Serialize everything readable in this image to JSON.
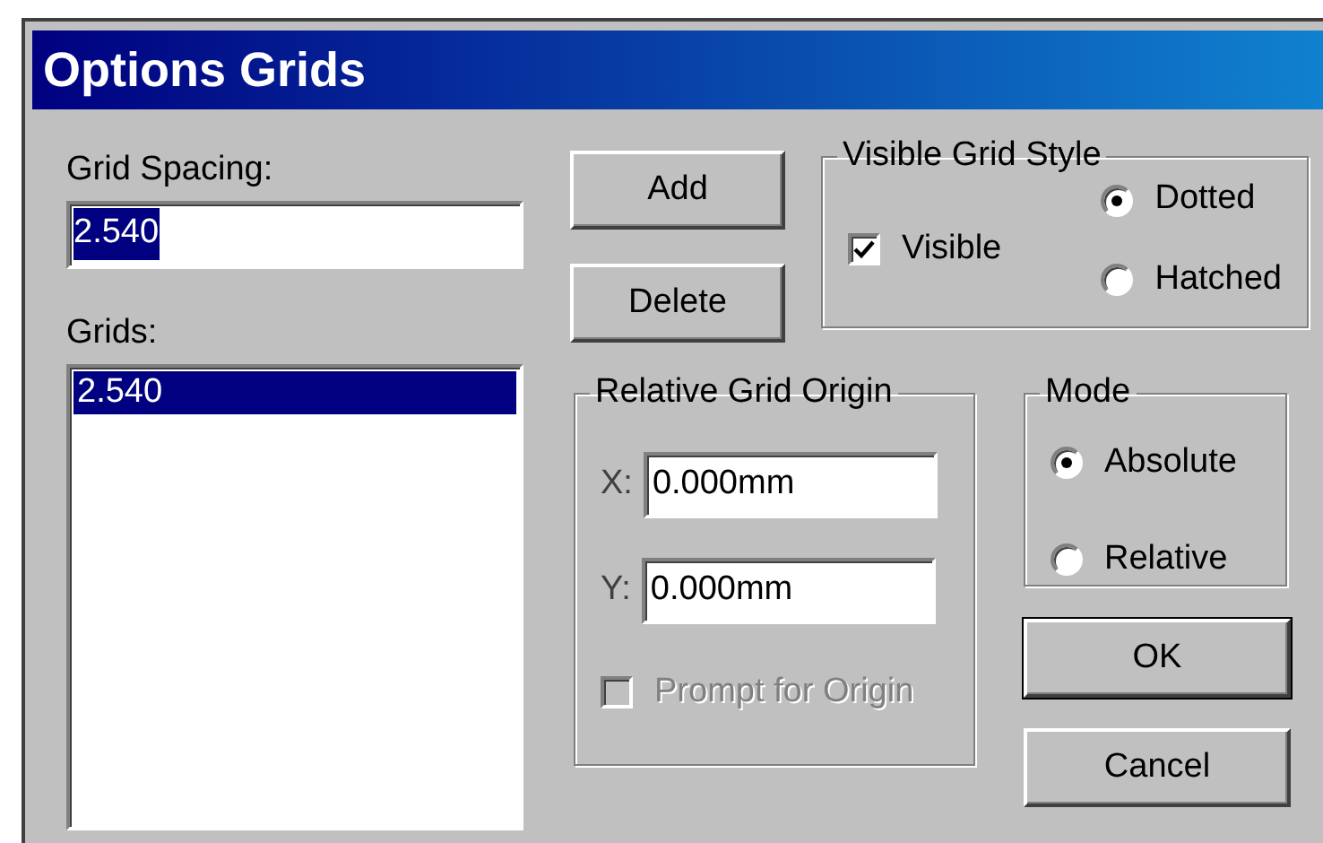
{
  "window": {
    "title": "Options Grids"
  },
  "grid_spacing": {
    "label": "Grid Spacing:",
    "value": "2.540",
    "selected": true
  },
  "grids": {
    "label": "Grids:",
    "items": [
      {
        "text": "2.540",
        "selected": true
      }
    ]
  },
  "buttons": [
    {
      "label": "Add"
    },
    {
      "label": "Delete"
    }
  ],
  "visible_grid_style": {
    "title": "Visible Grid Style",
    "visible": {
      "label": "Visible",
      "checked": true
    },
    "options": [
      {
        "label": "Dotted",
        "selected": true
      },
      {
        "label": "Hatched",
        "selected": false
      }
    ]
  },
  "relative_grid_origin": {
    "title": "Relative Grid Origin",
    "fields": [
      {
        "label": "X:",
        "value": "0.000mm"
      },
      {
        "label": "Y:",
        "value": "0.000mm"
      }
    ],
    "prompt": {
      "label": "Prompt for Origin",
      "checked": false,
      "disabled": true
    }
  },
  "mode": {
    "title": "Mode",
    "options": [
      {
        "label": "Absolute",
        "selected": true
      },
      {
        "label": "Relative",
        "selected": false
      }
    ]
  },
  "dialog_buttons": [
    {
      "label": "OK",
      "default": true
    },
    {
      "label": "Cancel",
      "default": false
    }
  ]
}
